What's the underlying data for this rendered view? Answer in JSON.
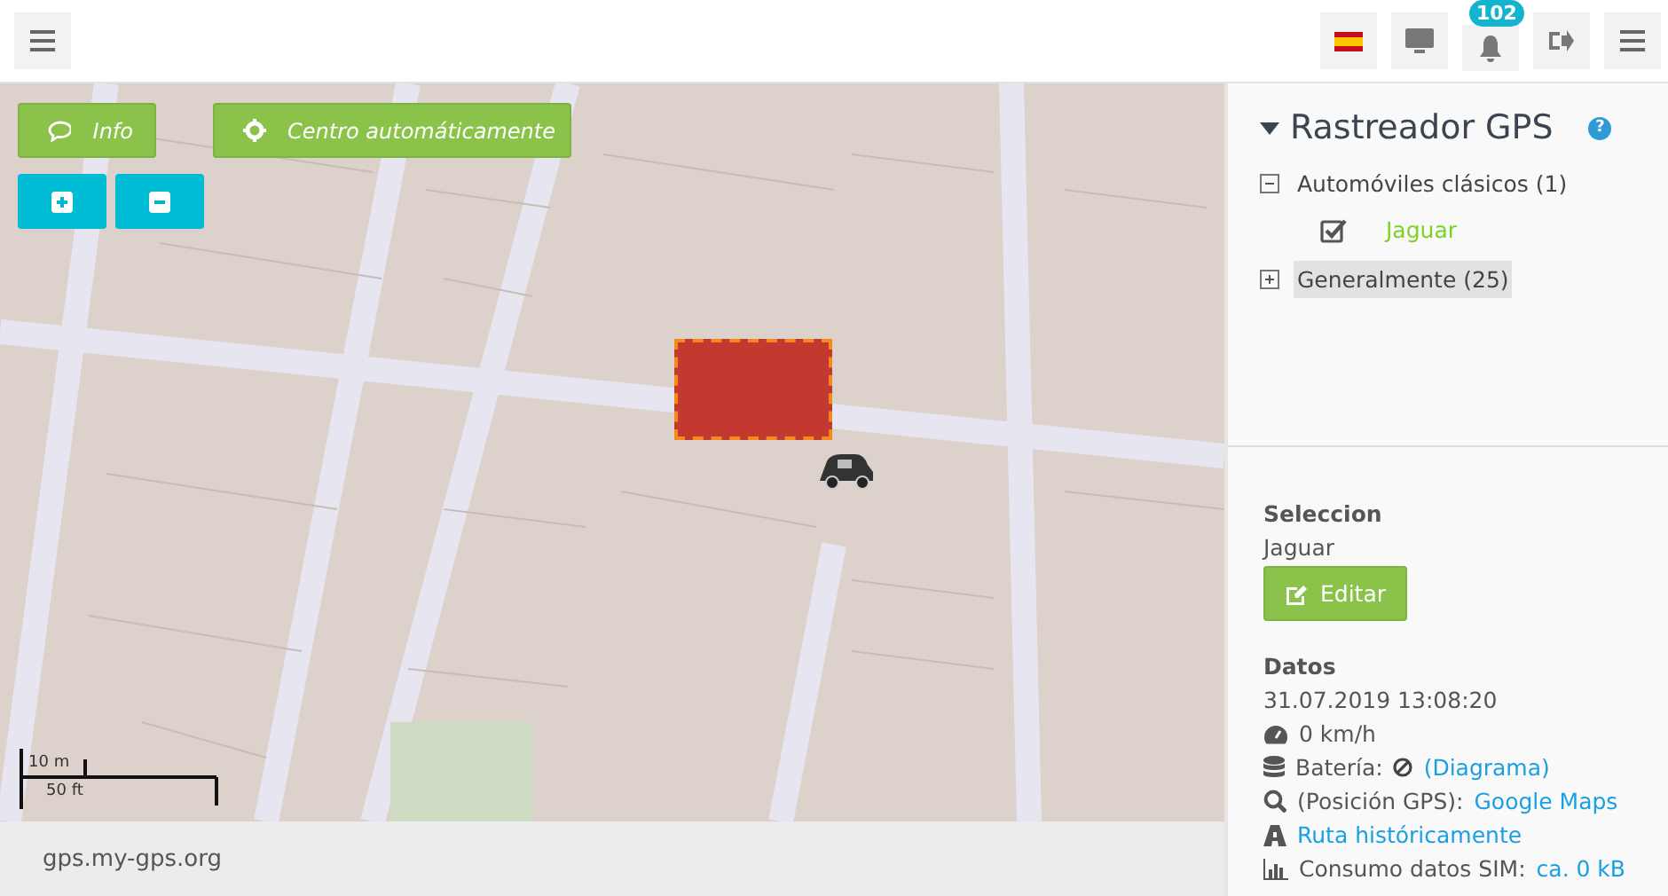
{
  "topbar": {
    "notifications_badge": "102"
  },
  "map": {
    "buttons": [
      {
        "kind": "info",
        "label": "Info"
      },
      {
        "kind": "center",
        "label": "Centro automáticamente"
      }
    ],
    "scale": {
      "metric": "10 m",
      "imperial": "50 ft"
    }
  },
  "footer": {
    "text": "gps.my-gps.org"
  },
  "panel": {
    "title": "Rastreador GPS",
    "help": "?",
    "expanded": true,
    "groups": [
      {
        "label": "Automóviles clásicos (1)",
        "expanded": true,
        "selected": false,
        "children": [
          {
            "label": "Jaguar",
            "checked": true
          }
        ]
      },
      {
        "label": "Generalmente (25)",
        "expanded": false,
        "selected": true
      }
    ],
    "selection": {
      "heading": "Seleccion",
      "value": "Jaguar",
      "button": "Editar"
    },
    "data": {
      "heading": "Datos",
      "timestamp": "31.07.2019 13:08:20",
      "rows": [
        {
          "kind": "speed",
          "label": "0 km/h"
        },
        {
          "kind": "battery",
          "label": "Batería:",
          "link": "(Diagrama)"
        },
        {
          "kind": "search",
          "label": "(Posición GPS):",
          "link": "Google Maps"
        },
        {
          "kind": "route",
          "link": "Ruta históricamente"
        },
        {
          "kind": "chart",
          "label": "Consumo datos SIM:",
          "link": "ca. 0 kB"
        }
      ]
    }
  }
}
